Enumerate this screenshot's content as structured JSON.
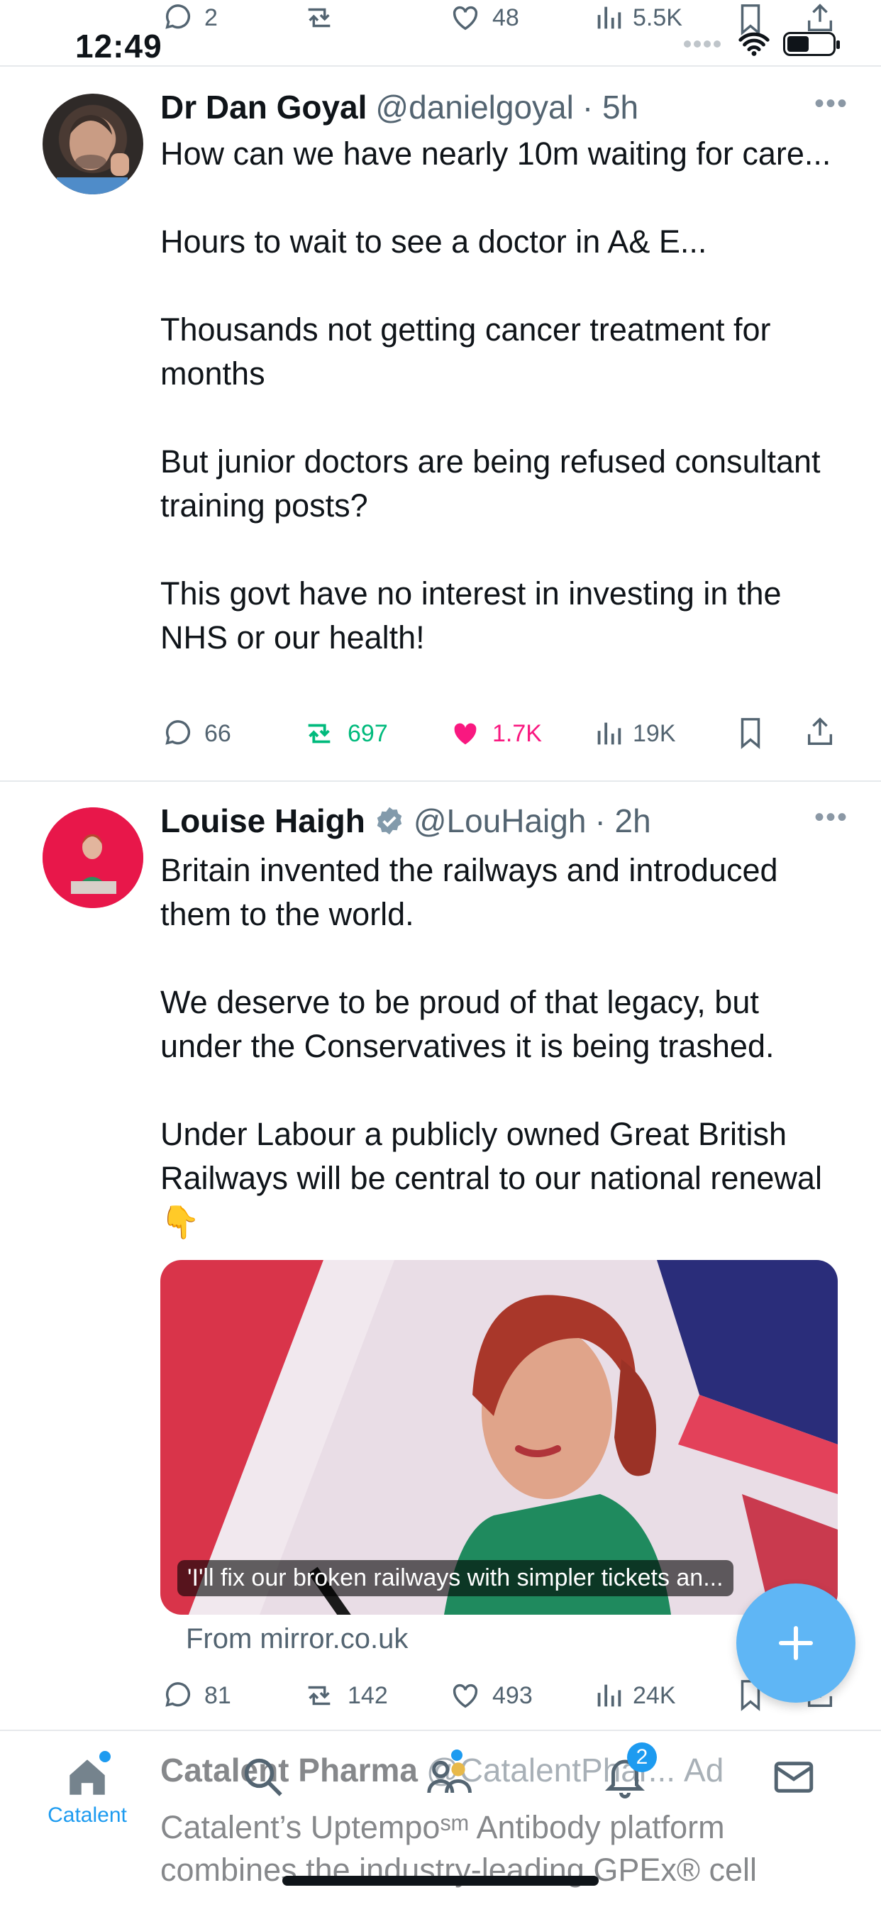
{
  "status_bar": {
    "time": "12:49"
  },
  "top_action_row": {
    "reply_count": "2",
    "like_count": "48",
    "views": "5.5K"
  },
  "tweets": [
    {
      "name": "Dr Dan Goyal",
      "handle": "@danielgoyal",
      "time": "· 5h",
      "paragraphs": [
        "How can we have nearly 10m waiting for care...",
        "Hours to wait to see a doctor in A& E...",
        "Thousands not getting cancer treatment for months",
        "But junior doctors are being refused consultant training posts?",
        "This govt have no interest in investing in the NHS or our health!"
      ],
      "replies": "66",
      "reposts": "697",
      "likes": "1.7K",
      "views": "19K"
    },
    {
      "name": "Louise Haigh",
      "handle": "@LouHaigh",
      "time": "· 2h",
      "paragraphs": [
        "Britain invented the railways and introduced them to the world.",
        "We deserve to be proud of that legacy, but under the Conservatives it is being trashed.",
        "Under Labour a publicly owned Great British Railways will be central to our national renewal 👇"
      ],
      "card_caption": "'I'll fix our broken railways with simpler tickets an...",
      "card_source": "From mirror.co.uk",
      "replies": "81",
      "reposts": "142",
      "likes": "493",
      "views": "24K"
    }
  ],
  "ad": {
    "name": "Catalent Pharma",
    "handle": "@CatalentPhar...",
    "ad_label": "Ad",
    "text": "Catalent’s Uptempoˢᵐ Antibody platform combines the industry-leading GPEx® cell"
  },
  "tabbar": {
    "home_label": "Catalent",
    "notification_count": "2"
  },
  "colors": {
    "accent": "#1d9bf0",
    "repost_green": "#00ba7c",
    "like_pink": "#f91880",
    "muted": "#536471"
  }
}
